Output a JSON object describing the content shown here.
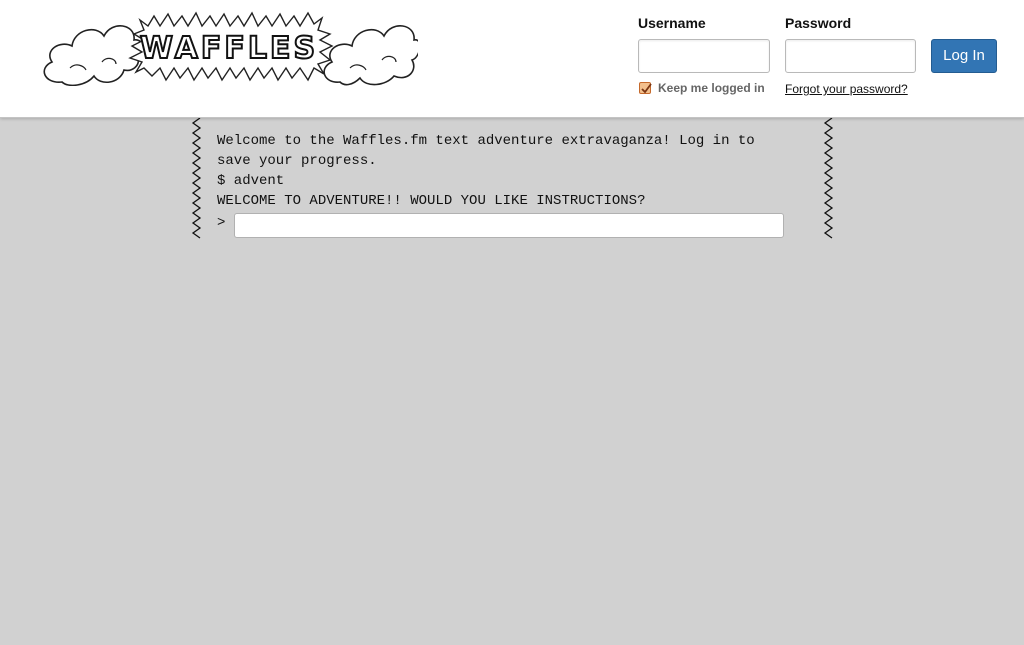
{
  "header": {
    "logo_text": "WAFFLES",
    "username_label": "Username",
    "username_value": "",
    "password_label": "Password",
    "password_value": "",
    "login_button": "Log In",
    "remember_label": "Keep me logged in",
    "remember_checked": true,
    "forgot_link": "Forgot your password?"
  },
  "terminal": {
    "lines": [
      "Welcome to the Waffles.fm text adventure extravaganza! Log in to save your progress.",
      "$ advent",
      "WELCOME TO ADVENTURE!! WOULD YOU LIKE INSTRUCTIONS?"
    ],
    "prompt": ">",
    "input_value": ""
  },
  "colors": {
    "background": "#d1d1d1",
    "header": "#ffffff",
    "button": "#3275b4",
    "checkbox": "#c5692b"
  }
}
